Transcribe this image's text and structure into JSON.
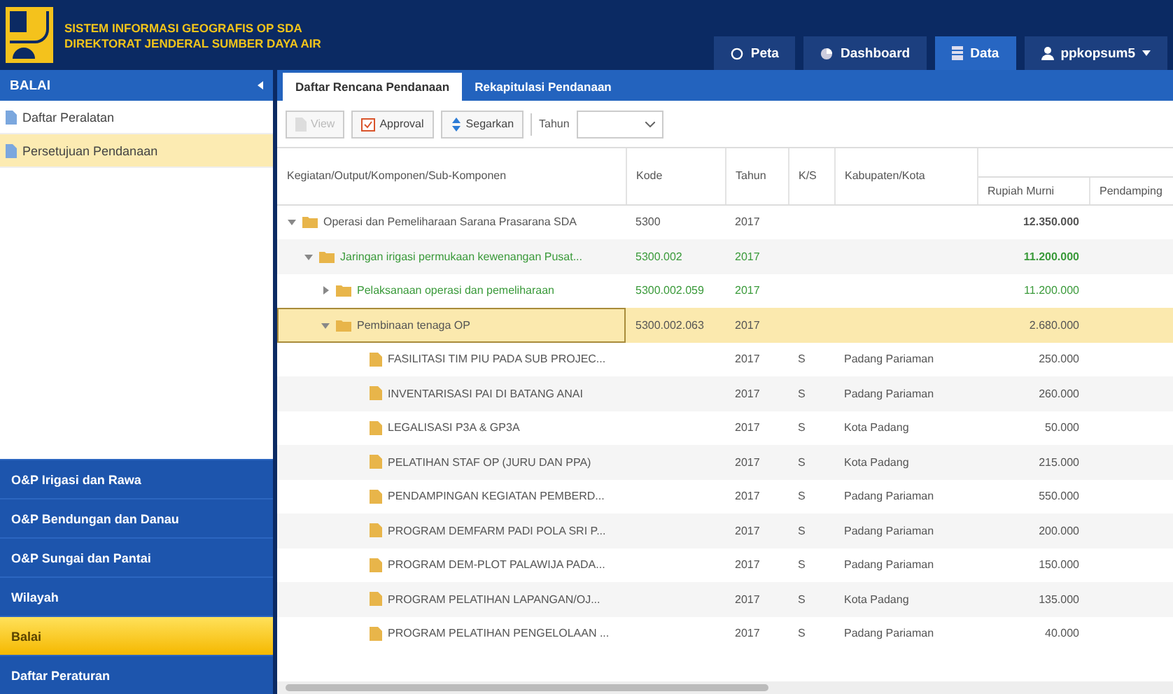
{
  "header": {
    "title_line_1": "SISTEM INFORMASI GEOGRAFIS OP SDA",
    "title_line_2": "DIREKTORAT JENDERAL SUMBER DAYA AIR"
  },
  "nav": [
    {
      "label": "Peta",
      "selected": false
    },
    {
      "label": "Dashboard",
      "selected": false
    },
    {
      "label": "Data",
      "selected": true
    },
    {
      "label": "ppkopsum5",
      "selected": false,
      "dropdown": true
    }
  ],
  "sidebar": {
    "title": "BALAI",
    "items": [
      {
        "label": "Daftar Peralatan",
        "selected": false
      },
      {
        "label": "Persetujuan Pendanaan",
        "selected": true
      }
    ],
    "menu": [
      {
        "label": "O&P Irigasi dan Rawa",
        "selected": false
      },
      {
        "label": "O&P Bendungan dan Danau",
        "selected": false
      },
      {
        "label": "O&P Sungai dan Pantai",
        "selected": false
      },
      {
        "label": "Wilayah",
        "selected": false
      },
      {
        "label": "Balai",
        "selected": true
      },
      {
        "label": "Daftar Peraturan",
        "selected": false
      }
    ]
  },
  "tabs": [
    {
      "label": "Daftar Rencana Pendanaan",
      "selected": true
    },
    {
      "label": "Rekapitulasi Pendanaan",
      "selected": false
    }
  ],
  "toolbar": {
    "buttons": [
      {
        "label": "View",
        "disabled": true
      },
      {
        "label": "Approval",
        "disabled": false
      },
      {
        "label": "Segarkan",
        "disabled": false
      }
    ],
    "year_label": "Tahun"
  },
  "table": {
    "columns": [
      "Kegiatan/Output/Komponen/Sub-Komponen",
      "Kode",
      "Tahun",
      "K/S",
      "Kabupaten/Kota"
    ],
    "subcolumns": [
      "Rupiah Murni",
      "Pendamping"
    ],
    "rows": [
      {
        "name": "Operasi dan Pemeliharaan Sarana Prasarana SDA",
        "kode": "5300",
        "tahun": "2017",
        "rupiah": "12.350.000",
        "kind": "group",
        "bold": true,
        "color": "#555555",
        "expanded": true,
        "selected": false,
        "children": [
          {
            "name": "Jaringan irigasi permukaan kewenangan Pusat...",
            "kode": "5300.002",
            "tahun": "2017",
            "rupiah": "11.200.000",
            "kind": "group",
            "bold": true,
            "color": "#3a9a3a",
            "expanded": true,
            "selected": false,
            "children": [
              {
                "name": "Pelaksanaan operasi dan pemeliharaan",
                "kode": "5300.002.059",
                "tahun": "2017",
                "rupiah": "11.200.000",
                "kind": "group",
                "bold": false,
                "color": "#3a9a3a",
                "expanded": false,
                "selected": false
              },
              {
                "name": "Pembinaan tenaga OP",
                "kode": "5300.002.063",
                "tahun": "2017",
                "rupiah": "2.680.000",
                "kind": "group",
                "bold": false,
                "color": "#555555",
                "expanded": true,
                "selected": true,
                "children": [
                  {
                    "name": "FASILITASI TIM PIU PADA SUB PROJEC...",
                    "tahun": "2017",
                    "ks": "S",
                    "kab": "Padang Pariaman",
                    "rupiah": "250.000",
                    "kind": "item",
                    "bold": false,
                    "color": "#555555",
                    "selected": false
                  },
                  {
                    "name": "INVENTARISASI PAI DI BATANG ANAI",
                    "tahun": "2017",
                    "ks": "S",
                    "kab": "Padang Pariaman",
                    "rupiah": "260.000",
                    "kind": "item",
                    "bold": false,
                    "color": "#555555",
                    "selected": false
                  },
                  {
                    "name": "LEGALISASI P3A & GP3A",
                    "tahun": "2017",
                    "ks": "S",
                    "kab": "Kota Padang",
                    "rupiah": "50.000",
                    "kind": "item",
                    "bold": false,
                    "color": "#555555",
                    "selected": false
                  },
                  {
                    "name": "PELATIHAN STAF OP (JURU DAN PPA)",
                    "tahun": "2017",
                    "ks": "S",
                    "kab": "Kota Padang",
                    "rupiah": "215.000",
                    "kind": "item",
                    "bold": false,
                    "color": "#555555",
                    "selected": false
                  },
                  {
                    "name": "PENDAMPINGAN KEGIATAN PEMBERD...",
                    "tahun": "2017",
                    "ks": "S",
                    "kab": "Padang Pariaman",
                    "rupiah": "550.000",
                    "kind": "item",
                    "bold": false,
                    "color": "#555555",
                    "selected": false
                  },
                  {
                    "name": "PROGRAM DEMFARM PADI POLA SRI P...",
                    "tahun": "2017",
                    "ks": "S",
                    "kab": "Padang Pariaman",
                    "rupiah": "200.000",
                    "kind": "item",
                    "bold": false,
                    "color": "#555555",
                    "selected": false
                  },
                  {
                    "name": "PROGRAM DEM-PLOT PALAWIJA PADA...",
                    "tahun": "2017",
                    "ks": "S",
                    "kab": "Padang Pariaman",
                    "rupiah": "150.000",
                    "kind": "item",
                    "bold": false,
                    "color": "#555555",
                    "selected": false
                  },
                  {
                    "name": "PROGRAM PELATIHAN LAPANGAN/OJ...",
                    "tahun": "2017",
                    "ks": "S",
                    "kab": "Kota Padang",
                    "rupiah": "135.000",
                    "kind": "item",
                    "bold": false,
                    "color": "#555555",
                    "selected": false
                  },
                  {
                    "name": "PROGRAM PELATIHAN PENGELOLAAN ...",
                    "tahun": "2017",
                    "ks": "S",
                    "kab": "Padang Pariaman",
                    "rupiah": "40.000",
                    "kind": "item",
                    "bold": false,
                    "color": "#555555",
                    "selected": false
                  }
                ]
              }
            ]
          }
        ]
      }
    ]
  }
}
